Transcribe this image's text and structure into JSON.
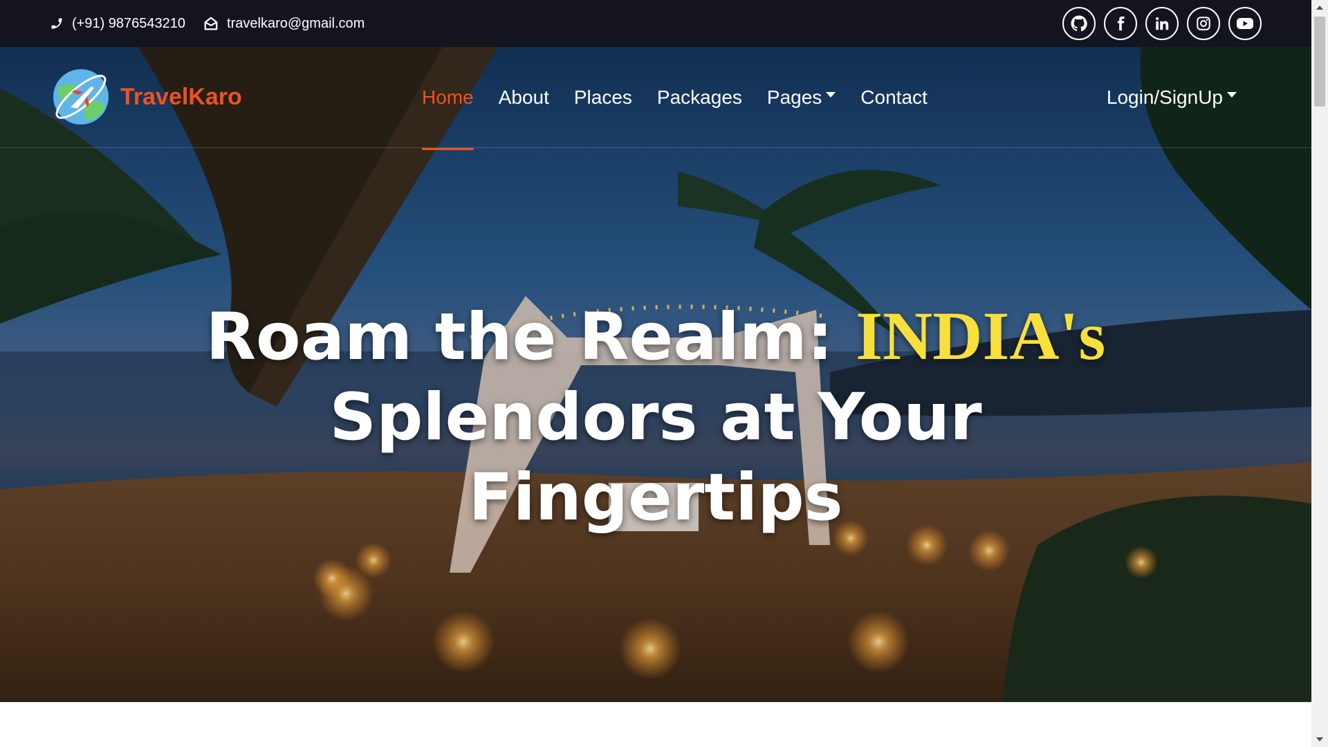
{
  "topbar": {
    "phone": "(+91) 9876543210",
    "email": "travelkaro@gmail.com",
    "socials": [
      {
        "icon": "github-icon"
      },
      {
        "icon": "facebook-icon"
      },
      {
        "icon": "linkedin-icon"
      },
      {
        "icon": "instagram-icon"
      },
      {
        "icon": "youtube-icon"
      }
    ]
  },
  "brand": {
    "name": "TravelKaro"
  },
  "nav": {
    "items": [
      {
        "label": "Home",
        "active": true
      },
      {
        "label": "About"
      },
      {
        "label": "Places"
      },
      {
        "label": "Packages"
      },
      {
        "label": "Pages",
        "dropdown": true
      },
      {
        "label": "Contact"
      }
    ],
    "login_label": "Login/SignUp"
  },
  "hero": {
    "line1_prefix": "Roam the Realm: ",
    "line1_accent": "INDIA's",
    "line2": "Splendors at Your",
    "line3": "Fingertips"
  },
  "colors": {
    "accent": "#f0521f",
    "highlight": "#f7e03c",
    "topbar_bg": "#14141f"
  }
}
